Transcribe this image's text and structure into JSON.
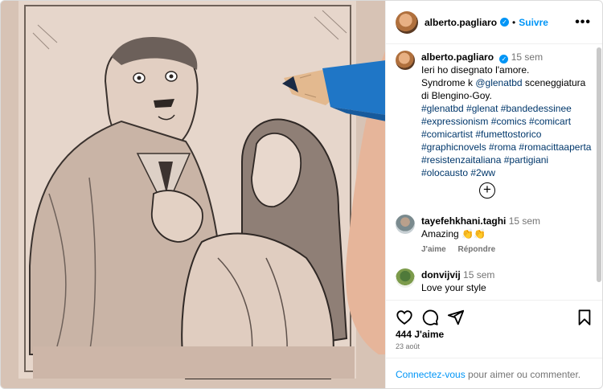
{
  "post": {
    "username": "alberto.pagliaro",
    "follow_label": "Suivre",
    "more_label": "•••",
    "dot": "•",
    "verified_mark": "✓"
  },
  "caption": {
    "username": "alberto.pagliaro",
    "time": "15 sem",
    "text_1": "Ieri ho disegnato l'amore.",
    "text_2": "Syndrome k ",
    "mention": "@glenatbd",
    "text_3": " sceneggiatura di Blengino-Goy.",
    "hashtags": "#glenatbd #glenat #bandedessinee #expressionism #comics #comicart #comicartist #fumettostorico #graphicnovels #roma #romacittaaperta #resistenzaitaliana #partigiani #olocausto #2ww"
  },
  "load_more_label": "+",
  "comments": [
    {
      "username": "tayefehkhani.taghi",
      "time": "15 sem",
      "text": "Amazing 👏👏",
      "like_label": "J'aime",
      "reply_label": "Répondre"
    },
    {
      "username": "donvijvij",
      "time": "15 sem",
      "text": "Love your style"
    }
  ],
  "icons": [
    "heart-icon",
    "comment-icon",
    "share-icon",
    "bookmark-icon"
  ],
  "stats": {
    "likes": "444 J'aime",
    "date": "23 août"
  },
  "footer": {
    "login_link": "Connectez-vous",
    "rest": " pour aimer ou commenter."
  },
  "colors": {
    "accent": "#0095f6",
    "link": "#00376b",
    "secondary_text": "#737373",
    "paper": "#d8c4b7",
    "pencil_blue": "#1f76c6"
  }
}
